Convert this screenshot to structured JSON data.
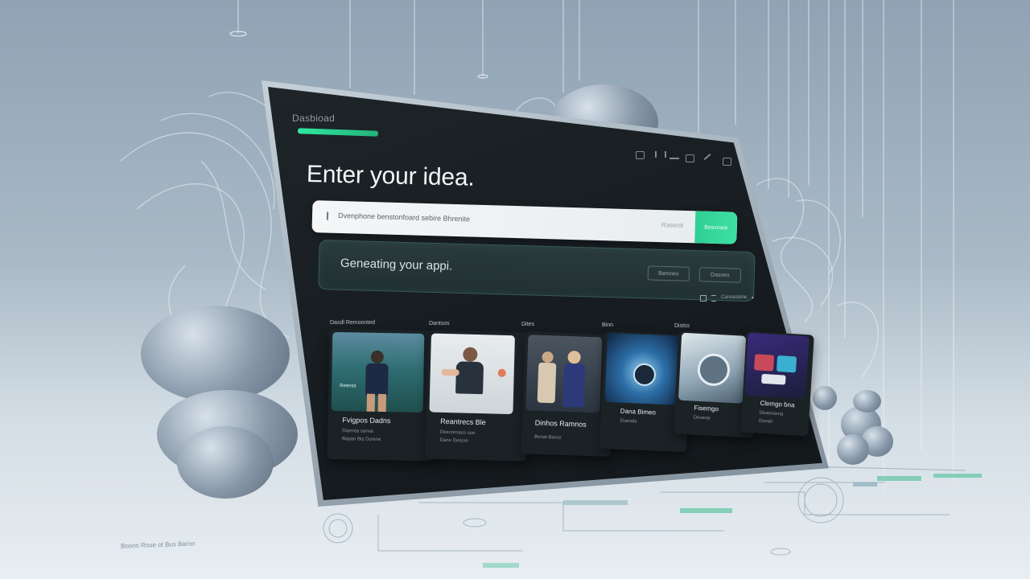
{
  "app": {
    "title": "Dasbioad"
  },
  "toolbar": {
    "icons": [
      "window-icon",
      "status-icon",
      "signal-icon",
      "link-icon",
      "edit-icon",
      "panel-icon"
    ]
  },
  "hero": {
    "heading": "Enter your idea."
  },
  "search": {
    "value": "Dvenphone benstonfoard sebire Bhrenite",
    "placeholder": "Rasenit",
    "button_label": "Besvoate"
  },
  "generation": {
    "status": "Geneating your appi.",
    "button_1": "Bamnex",
    "button_2": "Dasnex"
  },
  "filters": {
    "label": "Canvastone"
  },
  "categories": [
    "Dasdl Remoonted",
    "Dantsos",
    "Dites",
    "Binn",
    "Distss"
  ],
  "cards": [
    {
      "title": "Fvigpos Dadns",
      "sub": "Diarnoa sarwa",
      "sub2": "Bapan Bis Dunine",
      "thumb_label": "Reenss"
    },
    {
      "title": "Reantrecs Ble",
      "sub": "Deecornaco sue",
      "sub2": "Dane Desore",
      "thumb_label": ""
    },
    {
      "title": "Dinhos Ramnos",
      "sub": "Bonat Baroo",
      "sub2": "",
      "thumb_label": ""
    },
    {
      "title": "Dana Bimeo",
      "sub": "Duenda",
      "sub2": "",
      "thumb_label": ""
    },
    {
      "title": "Fisemgo",
      "sub": "Dovena",
      "sub2": "",
      "thumb_label": ""
    },
    {
      "title": "Clemgo bna",
      "sub": "Diuenrarna",
      "sub2": "Dovan",
      "thumb_label": ""
    }
  ],
  "floor": {
    "caption": "Boons Roue ot Bus Baron"
  },
  "colors": {
    "accent": "#2ee89e",
    "screen_bg": "#181e22",
    "background": "#a9b9c6"
  }
}
